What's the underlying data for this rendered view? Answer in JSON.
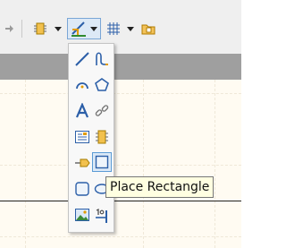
{
  "toolbar": {
    "items": [
      {
        "name": "navigate-arrow-icon"
      },
      {
        "name": "component-icon"
      },
      {
        "name": "place-wire-tool-icon",
        "active": true
      },
      {
        "name": "grid-icon"
      },
      {
        "name": "folder-icon"
      }
    ]
  },
  "palette": {
    "items": [
      {
        "name": "line-icon"
      },
      {
        "name": "bezier-icon"
      },
      {
        "name": "arc-icon"
      },
      {
        "name": "polygon-icon"
      },
      {
        "name": "text-icon"
      },
      {
        "name": "link-icon"
      },
      {
        "name": "text-frame-icon"
      },
      {
        "name": "part-icon"
      },
      {
        "name": "port-icon"
      },
      {
        "name": "rectangle-icon",
        "selected": true
      },
      {
        "name": "rounded-rectangle-icon"
      },
      {
        "name": "ellipse-icon"
      },
      {
        "name": "image-icon"
      },
      {
        "name": "pin-icon"
      }
    ]
  },
  "tooltip": {
    "text": "Place Rectangle"
  },
  "colors": {
    "accent_blue": "#5b9bd5",
    "tooltip_bg": "#ffffe1",
    "band_gray": "#9f9f9f",
    "canvas_bg": "#fffbf2"
  }
}
